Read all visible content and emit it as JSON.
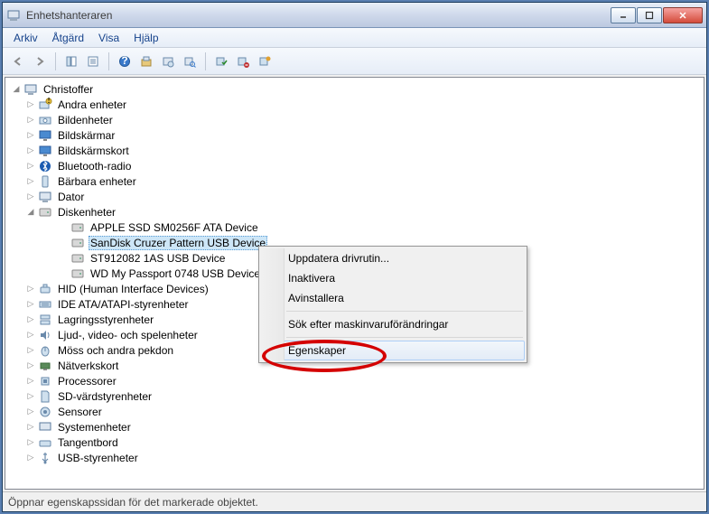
{
  "window": {
    "title": "Enhetshanteraren"
  },
  "menu": {
    "arkiv": "Arkiv",
    "atgard": "Åtgärd",
    "visa": "Visa",
    "hjalp": "Hjälp"
  },
  "tree": {
    "root": "Christoffer",
    "diskenheter": "Diskenheter",
    "disk_children": {
      "d0": "APPLE SSD SM0256F ATA Device",
      "d1": "SanDisk Cruzer Pattern USB Device",
      "d2": "ST912082 1AS USB Device",
      "d3": "WD My Passport 0748 USB Device"
    },
    "cats": {
      "andra": "Andra enheter",
      "bild": "Bildenheter",
      "skarmar": "Bildskärmar",
      "skarmskort": "Bildskärmskort",
      "bluetooth": "Bluetooth-radio",
      "barbara": "Bärbara enheter",
      "dator": "Dator",
      "hid": "HID (Human Interface Devices)",
      "ide": "IDE ATA/ATAPI-styrenheter",
      "lagring": "Lagringsstyrenheter",
      "ljud": "Ljud-, video- och spelenheter",
      "moss": "Möss och andra pekdon",
      "natverk": "Nätverkskort",
      "processorer": "Processorer",
      "sd": "SD-värdstyrenheter",
      "sensorer": "Sensorer",
      "system": "Systemenheter",
      "tangentbord": "Tangentbord",
      "usb": "USB-styrenheter"
    }
  },
  "context": {
    "uppdatera": "Uppdatera drivrutin...",
    "inaktivera": "Inaktivera",
    "avinstallera": "Avinstallera",
    "sok": "Sök efter maskinvaruförändringar",
    "egenskaper": "Egenskaper"
  },
  "status": "Öppnar egenskapssidan för det markerade objektet."
}
